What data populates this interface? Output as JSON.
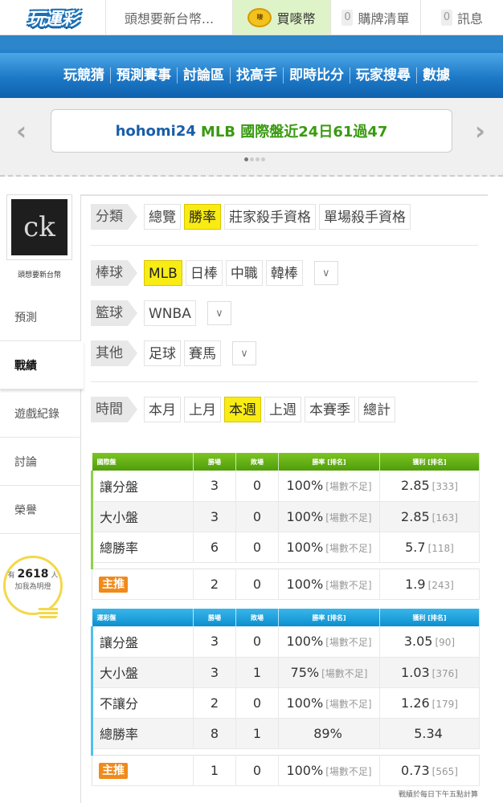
{
  "topbar": {
    "logo": "玩運彩",
    "user": "頭想要新台幣...",
    "coin_icon": "coin-icon",
    "coin_icon_text": "嘜",
    "buy_coins": "買嘜幣",
    "cart_count": "0",
    "cart": "購牌清單",
    "msg_count": "0",
    "msg": "訊息"
  },
  "nav": [
    "玩競猜",
    "預測賽事",
    "討論區",
    "找高手",
    "即時比分",
    "玩家搜尋",
    "數據"
  ],
  "banner": {
    "user": "hohomi24",
    "text": "MLB 國際盤近24日61過47",
    "prev": "‹",
    "next": "›"
  },
  "sidebar": {
    "avatar_text": "ck",
    "name": "頭想要新台幣",
    "items": [
      "預測",
      "戰績",
      "遊戲紀錄",
      "討論",
      "榮譽"
    ],
    "active": "戰績",
    "fans_prefix": "有",
    "fans_count": "2618",
    "fans_suffix": "人",
    "fans_cta": "加我為明燈"
  },
  "filters": {
    "category": {
      "label": "分類",
      "options": [
        "總覽",
        "勝率",
        "莊家殺手資格",
        "單場殺手資格"
      ],
      "selected": "勝率"
    },
    "baseball": {
      "label": "棒球",
      "options": [
        "MLB",
        "日棒",
        "中職",
        "韓棒"
      ],
      "selected": "MLB",
      "dropdown": "∨"
    },
    "basketball": {
      "label": "籃球",
      "options": [
        "WNBA"
      ],
      "dropdown": "∨"
    },
    "other": {
      "label": "其他",
      "options": [
        "足球",
        "賽馬"
      ],
      "dropdown": "∨"
    },
    "time": {
      "label": "時間",
      "options": [
        "本月",
        "上月",
        "本週",
        "上週",
        "本賽季",
        "總計"
      ],
      "selected": "本週"
    }
  },
  "intl_table": {
    "headers": [
      "國際盤",
      "勝場",
      "敗場",
      "勝率 [排名]",
      "獲利 [排名]"
    ],
    "rows": [
      {
        "type": "讓分盤",
        "win": "3",
        "lose": "0",
        "rate": "100%",
        "rate_rank": "[場數不足]",
        "profit": "2.85",
        "profit_rank": "[333]"
      },
      {
        "type": "大小盤",
        "win": "3",
        "lose": "0",
        "rate": "100%",
        "rate_rank": "[場數不足]",
        "profit": "2.85",
        "profit_rank": "[163]"
      },
      {
        "type": "總勝率",
        "win": "6",
        "lose": "0",
        "rate": "100%",
        "rate_rank": "[場數不足]",
        "profit": "5.7",
        "profit_rank": "[118]"
      }
    ],
    "main": {
      "type": "主推",
      "win": "2",
      "lose": "0",
      "rate": "100%",
      "rate_rank": "[場數不足]",
      "profit": "1.9",
      "profit_rank": "[243]"
    }
  },
  "lottery_table": {
    "headers": [
      "運彩盤",
      "勝場",
      "敗場",
      "勝率 [排名]",
      "獲利 [排名]"
    ],
    "rows": [
      {
        "type": "讓分盤",
        "win": "3",
        "lose": "0",
        "rate": "100%",
        "rate_rank": "[場數不足]",
        "profit": "3.05",
        "profit_rank": "[90]"
      },
      {
        "type": "大小盤",
        "win": "3",
        "lose": "1",
        "rate": "75%",
        "rate_rank": "[場數不足]",
        "profit": "1.03",
        "profit_rank": "[376]"
      },
      {
        "type": "不讓分",
        "win": "2",
        "lose": "0",
        "rate": "100%",
        "rate_rank": "[場數不足]",
        "profit": "1.26",
        "profit_rank": "[179]"
      },
      {
        "type": "總勝率",
        "win": "8",
        "lose": "1",
        "rate": "89%",
        "rate_rank": "",
        "profit": "5.34",
        "profit_rank": ""
      }
    ],
    "main": {
      "type": "主推",
      "win": "1",
      "lose": "0",
      "rate": "100%",
      "rate_rank": "[場數不足]",
      "profit": "0.73",
      "profit_rank": "[565]"
    }
  },
  "footnote": "戰績於每日下午五點計算"
}
